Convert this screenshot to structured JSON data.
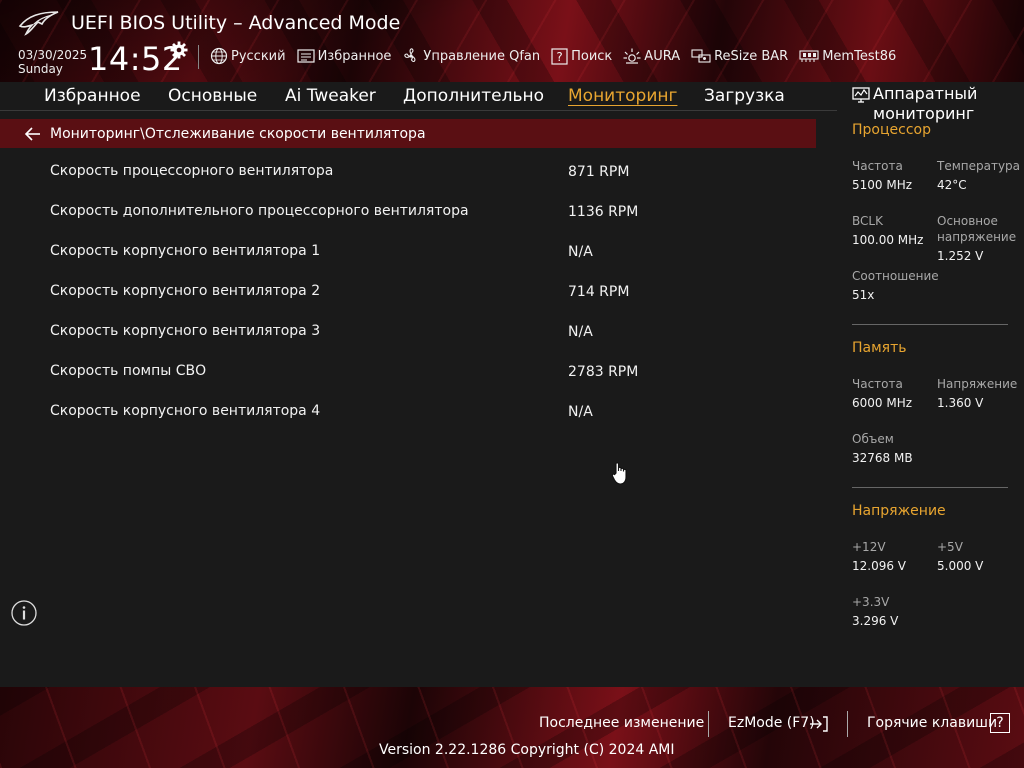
{
  "header": {
    "title": "UEFI BIOS Utility – Advanced Mode",
    "date": "03/30/2025",
    "day": "Sunday",
    "time": "14:52",
    "toolbar": [
      {
        "label": "Русский",
        "icon": "globe-icon"
      },
      {
        "label": "Избранное",
        "icon": "favorites-icon"
      },
      {
        "label": "Управление Qfan",
        "icon": "fan-icon"
      },
      {
        "label": "Поиск",
        "icon": "help-search-icon"
      },
      {
        "label": "AURA",
        "icon": "aura-icon"
      },
      {
        "label": "ReSize BAR",
        "icon": "resize-bar-icon"
      },
      {
        "label": "MemTest86",
        "icon": "memtest-icon"
      }
    ]
  },
  "tabs": [
    {
      "label": "Избранное",
      "active": false
    },
    {
      "label": "Основные",
      "active": false
    },
    {
      "label": "Ai Tweaker",
      "active": false
    },
    {
      "label": "Дополнительно",
      "active": false
    },
    {
      "label": "Мониторинг",
      "active": true
    },
    {
      "label": "Загрузка",
      "active": false
    }
  ],
  "breadcrumb": "Мониторинг\\Отслеживание скорости вентилятора",
  "rows": [
    {
      "label": "Скорость процессорного вентилятора",
      "value": "871 RPM"
    },
    {
      "label": "Скорость дополнительного процессорного вентилятора",
      "value": "1136 RPM"
    },
    {
      "label": "Скорость корпусного вентилятора 1",
      "value": "N/A"
    },
    {
      "label": "Скорость корпусного вентилятора 2",
      "value": "714 RPM"
    },
    {
      "label": "Скорость корпусного вентилятора 3",
      "value": "N/A"
    },
    {
      "label": "Скорость помпы СВО",
      "value": "2783 RPM"
    },
    {
      "label": "Скорость корпусного вентилятора 4",
      "value": "N/A"
    }
  ],
  "sidebar": {
    "title": "Аппаратный мониторинг",
    "cpu": {
      "heading": "Процессор",
      "freq_label": "Частота",
      "freq": "5100 MHz",
      "temp_label": "Температура",
      "temp": "42°C",
      "bclk_label": "BCLK",
      "bclk": "100.00 MHz",
      "vcore_label": "Основное напряжение",
      "vcore": "1.252 V",
      "ratio_label": "Соотношение",
      "ratio": "51x"
    },
    "memory": {
      "heading": "Память",
      "freq_label": "Частота",
      "freq": "6000 MHz",
      "volt_label": "Напряжение",
      "volt": "1.360 V",
      "size_label": "Объем",
      "size": "32768 MB"
    },
    "voltage": {
      "heading": "Напряжение",
      "v12_label": "+12V",
      "v12": "12.096 V",
      "v5_label": "+5V",
      "v5": "5.000 V",
      "v33_label": "+3.3V",
      "v33": "3.296 V"
    }
  },
  "footer": {
    "last_change": "Последнее изменение",
    "ezmode": "EzMode (F7)",
    "hotkeys": "Горячие клавиши",
    "hotkeys_key": "?",
    "version": "Version 2.22.1286 Copyright (C) 2024 AMI"
  },
  "colors": {
    "accent": "#e8a530",
    "breadcrumb_bg": "#5a0f13",
    "panel_bg": "#1a1a1a"
  }
}
